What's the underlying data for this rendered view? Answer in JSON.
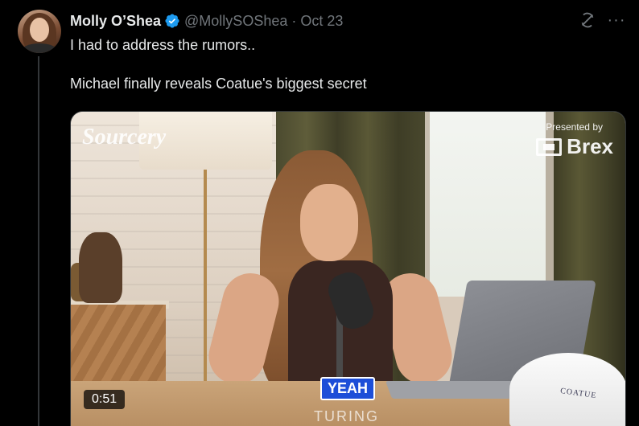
{
  "tweet": {
    "author_name": "Molly O’Shea",
    "handle": "@MollySOShea",
    "separator": "·",
    "timestamp": "Oct 23",
    "text_line1": "I had to address the rumors..",
    "text_line2": "Michael finally reveals Coatue's biggest secret"
  },
  "icons": {
    "verified": "verified-badge-icon",
    "grok": "grok-icon",
    "more": "more-icon"
  },
  "more_glyph": "···",
  "video": {
    "brand_left": "Sourcery",
    "sponsor_prefix": "Presented by",
    "sponsor_name": "Brex",
    "caption": "YEAH",
    "watermark": "TURING",
    "duration": "0:51",
    "cap_text": "COATUE"
  },
  "colors": {
    "verified": "#1d9bf0",
    "muted": "#71767b",
    "caption_bg": "#1d4ed8"
  }
}
